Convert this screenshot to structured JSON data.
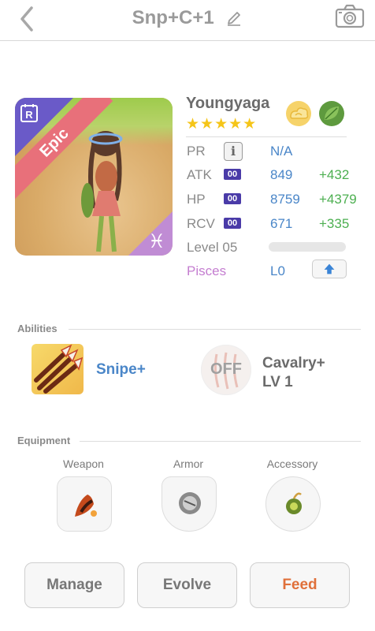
{
  "header": {
    "title": "Snp+C+1",
    "back_icon": "chevron-left-icon",
    "edit_icon": "pencil-icon",
    "camera_icon": "camera-icon"
  },
  "card": {
    "rarity": "Epic",
    "rarity_badge": "R",
    "zodiac_symbol": "♓",
    "name": "Youngyaga",
    "stars": "★★★★★",
    "star_count": 5,
    "element_icons": [
      "cloud-icon",
      "leaf-icon"
    ]
  },
  "stats": {
    "pr": {
      "label": "PR",
      "value": "N/A",
      "info": "i"
    },
    "atk": {
      "label": "ATK",
      "badge": "00",
      "value": "849",
      "bonus": "+432"
    },
    "hp": {
      "label": "HP",
      "badge": "00",
      "value": "8759",
      "bonus": "+4379"
    },
    "rcv": {
      "label": "RCV",
      "badge": "00",
      "value": "671",
      "bonus": "+335"
    },
    "level": {
      "label": "Level 05",
      "progress": 0
    },
    "zodiac": {
      "label": "Pisces",
      "value": "L0"
    }
  },
  "abilities": {
    "title": "Abilities",
    "primary": {
      "name": "Snipe+"
    },
    "secondary": {
      "state": "OFF",
      "name": "Cavalry+",
      "level": "LV 1"
    }
  },
  "equipment": {
    "title": "Equipment",
    "weapon": "Weapon",
    "armor": "Armor",
    "accessory": "Accessory"
  },
  "actions": {
    "manage": "Manage",
    "evolve": "Evolve",
    "feed": "Feed"
  },
  "colors": {
    "accent_blue": "#4a86c8",
    "bonus_green": "#4caf50",
    "feed_orange": "#e0703a",
    "epic_pink": "#e8707a",
    "star_gold": "#f5c518"
  }
}
